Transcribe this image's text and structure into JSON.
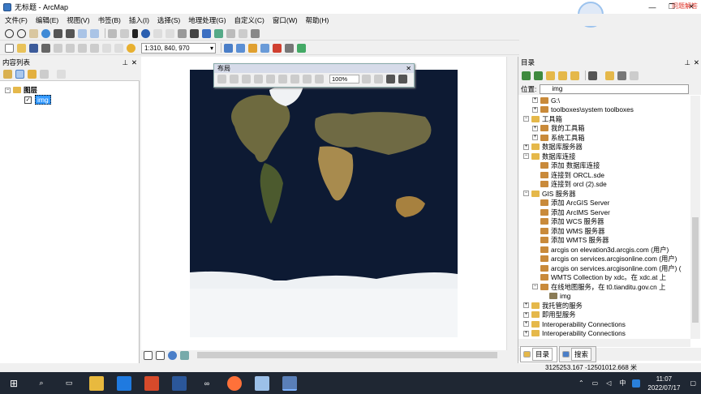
{
  "window": {
    "title": "无标题 - ArcMap",
    "min": "—",
    "restore": "❐",
    "close": "✕"
  },
  "menu": [
    "文件(F)",
    "编辑(E)",
    "视图(V)",
    "书签(B)",
    "插入(I)",
    "选择(S)",
    "地理处理(G)",
    "自定义(C)",
    "窗口(W)",
    "帮助(H)"
  ],
  "toolbar": {
    "scale": "1:310, 840, 970"
  },
  "toc": {
    "title": "内容列表",
    "group": "图层",
    "layer": "img"
  },
  "layout_toolbar": {
    "title": "布局",
    "zoom": "100%"
  },
  "catalog": {
    "title": "目录",
    "location_label": "位置:",
    "location_value": "img",
    "tab_catalog": "目录",
    "tab_search": "搜索",
    "items": [
      {
        "label": "G:\\",
        "level": 2,
        "exp": "+"
      },
      {
        "label": "toolboxes\\system toolboxes",
        "level": 2,
        "exp": "+"
      },
      {
        "label": "工具箱",
        "level": 1,
        "exp": "−"
      },
      {
        "label": "我的工具箱",
        "level": 2,
        "exp": "+"
      },
      {
        "label": "系统工具箱",
        "level": 2,
        "exp": "+"
      },
      {
        "label": "数据库服务器",
        "level": 1,
        "exp": "+"
      },
      {
        "label": "数据库连接",
        "level": 1,
        "exp": "−"
      },
      {
        "label": "添加 数据库连接",
        "level": 2,
        "exp": ""
      },
      {
        "label": "连接到 ORCL.sde",
        "level": 2,
        "exp": ""
      },
      {
        "label": "连接到 orcl (2).sde",
        "level": 2,
        "exp": ""
      },
      {
        "label": "GIS 服务器",
        "level": 1,
        "exp": "−"
      },
      {
        "label": "添加 ArcGIS Server",
        "level": 2,
        "exp": ""
      },
      {
        "label": "添加 ArcIMS Server",
        "level": 2,
        "exp": ""
      },
      {
        "label": "添加 WCS 服务器",
        "level": 2,
        "exp": ""
      },
      {
        "label": "添加 WMS 服务器",
        "level": 2,
        "exp": ""
      },
      {
        "label": "添加 WMTS 服务器",
        "level": 2,
        "exp": ""
      },
      {
        "label": "arcgis on elevation3d.arcgis.com (用户)",
        "level": 2,
        "exp": ""
      },
      {
        "label": "arcgis on services.arcgisonline.com (用户)",
        "level": 2,
        "exp": ""
      },
      {
        "label": "arcgis on services.arcgisonline.com (用户) (",
        "level": 2,
        "exp": ""
      },
      {
        "label": "WMTS Collection by xdc。在 xdc.at 上",
        "level": 2,
        "exp": ""
      },
      {
        "label": "在线地图服务，在 t0.tianditu.gov.cn 上",
        "level": 2,
        "exp": "−"
      },
      {
        "label": "img",
        "level": 3,
        "exp": ""
      },
      {
        "label": "我托管的服务",
        "level": 1,
        "exp": "+"
      },
      {
        "label": "即用型服务",
        "level": 1,
        "exp": "+"
      },
      {
        "label": "Interoperability Connections",
        "level": 1,
        "exp": "+"
      },
      {
        "label": "Interoperability Connections",
        "level": 1,
        "exp": "+"
      }
    ]
  },
  "status": {
    "coords": "3125253.167  -12501012.668 米"
  },
  "taskbar": {
    "time": "11:07",
    "date": "2022/07/17",
    "ime_lang": "英",
    "tray_ime": "中"
  },
  "watermark": "问题解答",
  "colors": {
    "accent": "#3a78c3",
    "taskbar": "#1f2733",
    "selection": "#3399ff"
  }
}
